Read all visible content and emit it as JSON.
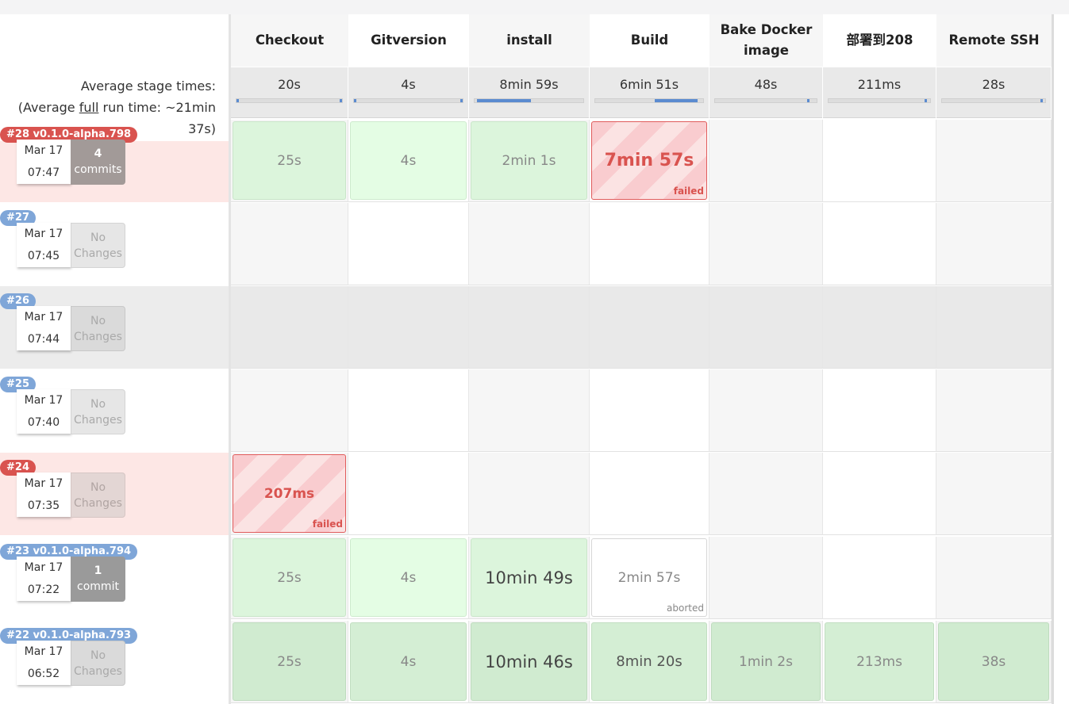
{
  "stages": [
    "Checkout",
    "Gitversion",
    "install",
    "Build",
    "Bake Docker image",
    "部署到208",
    "Remote SSH"
  ],
  "average": {
    "label_line1": "Average stage times:",
    "label_prefix": "(Average ",
    "label_link": "full",
    "label_suffix": " run time: ~21min",
    "label_line3": "37s)",
    "times": [
      "20s",
      "4s",
      "8min 59s",
      "6min 51s",
      "48s",
      "211ms",
      "28s"
    ]
  },
  "runs": [
    {
      "badge": "#28 v0.1.0-alpha.798",
      "date": "Mar 17",
      "time": "07:47",
      "changes_count": "4",
      "changes_text": "commits",
      "stages": [
        "25s",
        "4s",
        "2min 1s",
        "7min 57s",
        "",
        "",
        ""
      ],
      "status": [
        "",
        "",
        "",
        "failed",
        "",
        "",
        ""
      ]
    },
    {
      "badge": "#27",
      "date": "Mar 17",
      "time": "07:45",
      "changes_count": "No",
      "changes_text": "Changes",
      "stages": [
        "",
        "",
        "",
        "",
        "",
        "",
        ""
      ],
      "status": [
        "",
        "",
        "",
        "",
        "",
        "",
        ""
      ]
    },
    {
      "badge": "#26",
      "date": "Mar 17",
      "time": "07:44",
      "changes_count": "No",
      "changes_text": "Changes",
      "stages": [
        "",
        "",
        "",
        "",
        "",
        "",
        ""
      ],
      "status": [
        "",
        "",
        "",
        "",
        "",
        "",
        ""
      ]
    },
    {
      "badge": "#25",
      "date": "Mar 17",
      "time": "07:40",
      "changes_count": "No",
      "changes_text": "Changes",
      "stages": [
        "",
        "",
        "",
        "",
        "",
        "",
        ""
      ],
      "status": [
        "",
        "",
        "",
        "",
        "",
        "",
        ""
      ]
    },
    {
      "badge": "#24",
      "date": "Mar 17",
      "time": "07:35",
      "changes_count": "No",
      "changes_text": "Changes",
      "stages": [
        "207ms",
        "",
        "",
        "",
        "",
        "",
        ""
      ],
      "status": [
        "failed",
        "",
        "",
        "",
        "",
        "",
        ""
      ]
    },
    {
      "badge": "#23 v0.1.0-alpha.794",
      "date": "Mar 17",
      "time": "07:22",
      "changes_count": "1",
      "changes_text": "commit",
      "stages": [
        "25s",
        "4s",
        "10min 49s",
        "2min 57s",
        "",
        "",
        ""
      ],
      "status": [
        "",
        "",
        "",
        "aborted",
        "",
        "",
        ""
      ]
    },
    {
      "badge": "#22 v0.1.0-alpha.793",
      "date": "Mar 17",
      "time": "06:52",
      "changes_count": "No",
      "changes_text": "Changes",
      "stages": [
        "25s",
        "4s",
        "10min 46s",
        "8min 20s",
        "1min 2s",
        "213ms",
        "38s"
      ],
      "status": [
        "",
        "",
        "",
        "",
        "",
        "",
        ""
      ]
    }
  ],
  "colors": {
    "failed": "#d9534f",
    "success": "#dcf5dc",
    "badge_blue": "#7fa6d8",
    "badge_red": "#d9534f"
  }
}
